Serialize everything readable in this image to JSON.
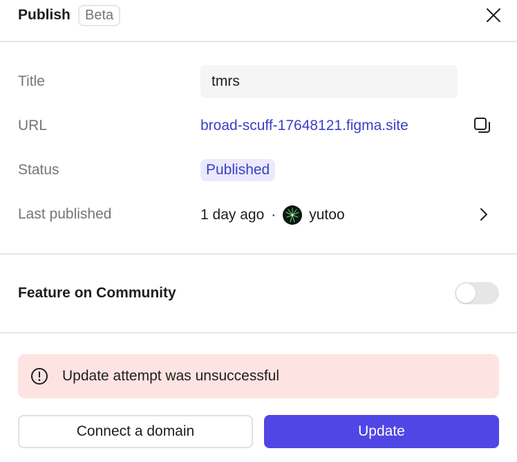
{
  "header": {
    "title": "Publish",
    "badge": "Beta"
  },
  "details": {
    "title_label": "Title",
    "title_value": "tmrs",
    "url_label": "URL",
    "url_value": "broad-scuff-17648121.figma.site",
    "status_label": "Status",
    "status_value": "Published",
    "last_published_label": "Last published",
    "last_published_time": "1 day ago",
    "separator": "·",
    "user": "yutoo"
  },
  "community": {
    "label": "Feature on Community",
    "enabled": false
  },
  "error": {
    "message": "Update attempt was unsuccessful"
  },
  "actions": {
    "connect_domain": "Connect a domain",
    "update": "Update"
  },
  "colors": {
    "accent": "#4f46e5",
    "link": "#3b3fc4",
    "status_bg": "#ebe9fd",
    "error_bg": "#fde3e1"
  },
  "icons": [
    "close-icon",
    "copy-icon",
    "chevron-right-icon",
    "alert-circle-icon"
  ]
}
